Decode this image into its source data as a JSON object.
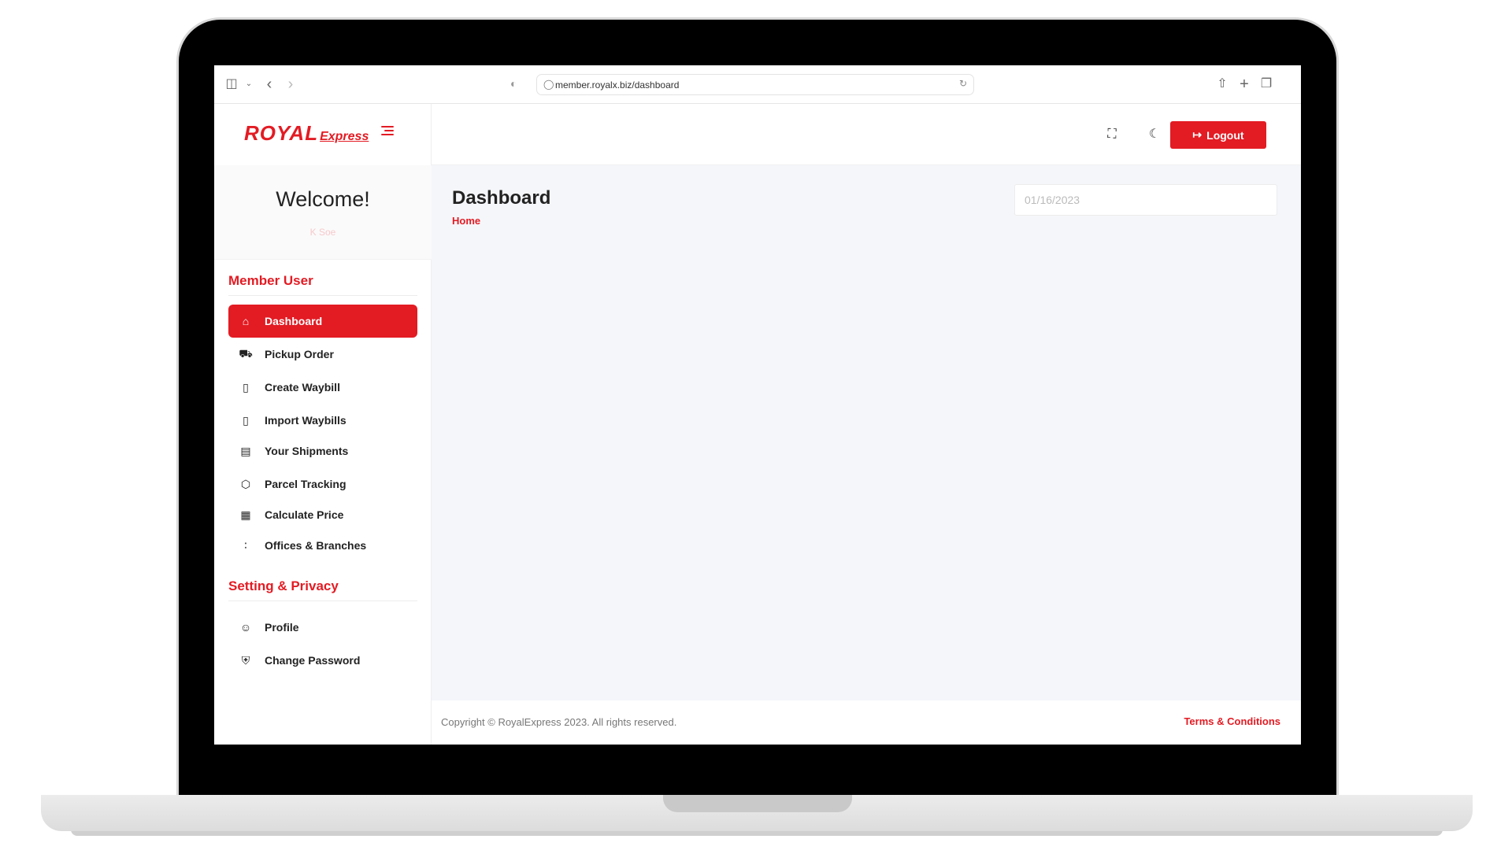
{
  "browser": {
    "url": "member.royalx.biz/dashboard"
  },
  "brand": {
    "logo_main": "ROYAL",
    "logo_sub": "Express",
    "accent_color": "#e31b23"
  },
  "topbar": {
    "logout_label": "Logout"
  },
  "sidebar": {
    "welcome": "Welcome!",
    "user_name": "K          Soe",
    "sections": [
      {
        "title": "Member User",
        "items": [
          {
            "label": "Dashboard",
            "icon": "home-icon",
            "active": true
          },
          {
            "label": "Pickup Order",
            "icon": "truck-icon"
          },
          {
            "label": "Create Waybill",
            "icon": "tablet-icon"
          },
          {
            "label": "Import Waybills",
            "icon": "tablet-icon"
          },
          {
            "label": "Your Shipments",
            "icon": "list-icon"
          },
          {
            "label": "Parcel Tracking",
            "icon": "package-icon"
          },
          {
            "label": "Calculate Price",
            "icon": "calculator-icon"
          },
          {
            "label": "Offices & Branches",
            "icon": "route-icon"
          }
        ]
      },
      {
        "title": "Setting & Privacy",
        "items": [
          {
            "label": "Profile",
            "icon": "user-icon"
          },
          {
            "label": "Change Password",
            "icon": "shield-icon"
          }
        ]
      }
    ]
  },
  "main": {
    "page_title": "Dashboard",
    "breadcrumb": "Home",
    "date_value": "01/16/2023"
  },
  "footer": {
    "copyright": "Copyright © RoyalExpress 2023. All rights reserved.",
    "terms": "Terms & Conditions"
  }
}
